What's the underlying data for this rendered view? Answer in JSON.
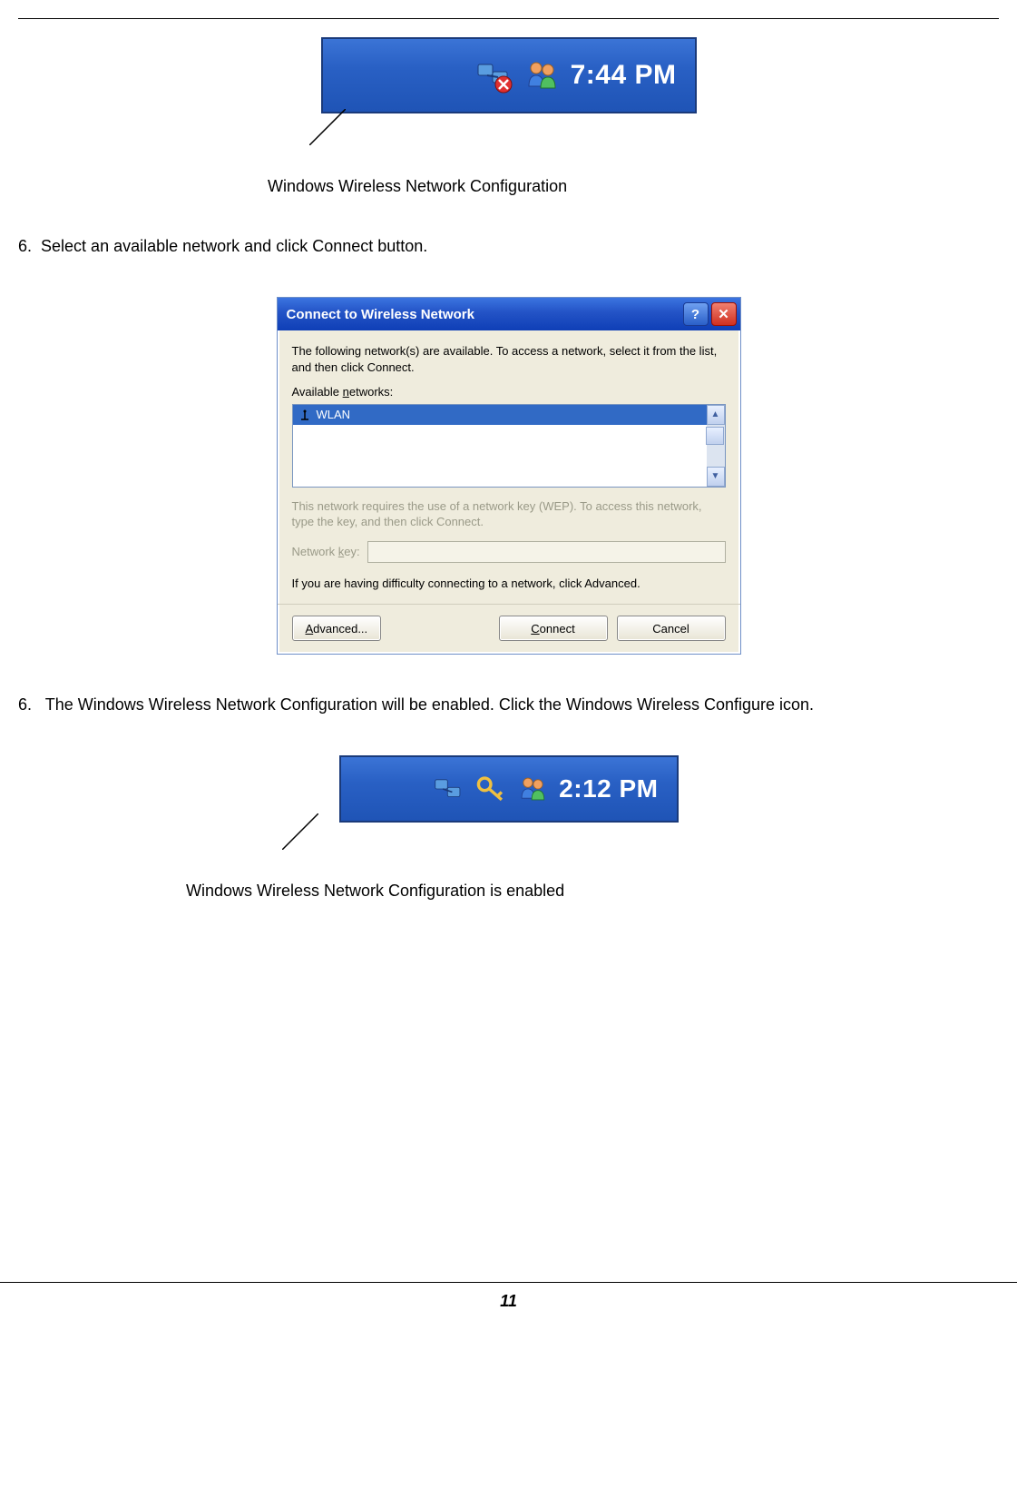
{
  "captions": {
    "caption1": "Windows Wireless Network Configuration",
    "caption2": "Windows Wireless Network Configuration is enabled"
  },
  "instructions": {
    "step5_number": "6.",
    "step5_text": "Select an available network and click Connect button.",
    "step6_number": "6.",
    "step6_text": "The Windows Wireless Network Configuration will be enabled. Click the Windows Wireless Configure icon."
  },
  "taskbar1": {
    "time": "7:44 PM"
  },
  "taskbar2": {
    "time": "2:12 PM"
  },
  "dialog": {
    "title": "Connect to Wireless Network",
    "intro": "The following network(s) are available. To access a network, select it from the list, and then click Connect.",
    "available_label_pre": "Available ",
    "available_label_u": "n",
    "available_label_post": "etworks:",
    "network_item": "WLAN",
    "wep_hint": "This network requires the use of a network key (WEP). To access this network, type the key, and then click Connect.",
    "key_label_pre": "Network ",
    "key_label_u": "k",
    "key_label_post": "ey:",
    "difficulty_text": "If you are having difficulty connecting to a network, click Advanced.",
    "btn_advanced_u": "A",
    "btn_advanced_rest": "dvanced...",
    "btn_connect_u": "C",
    "btn_connect_rest": "onnect",
    "btn_cancel": "Cancel"
  },
  "page_number": "11"
}
